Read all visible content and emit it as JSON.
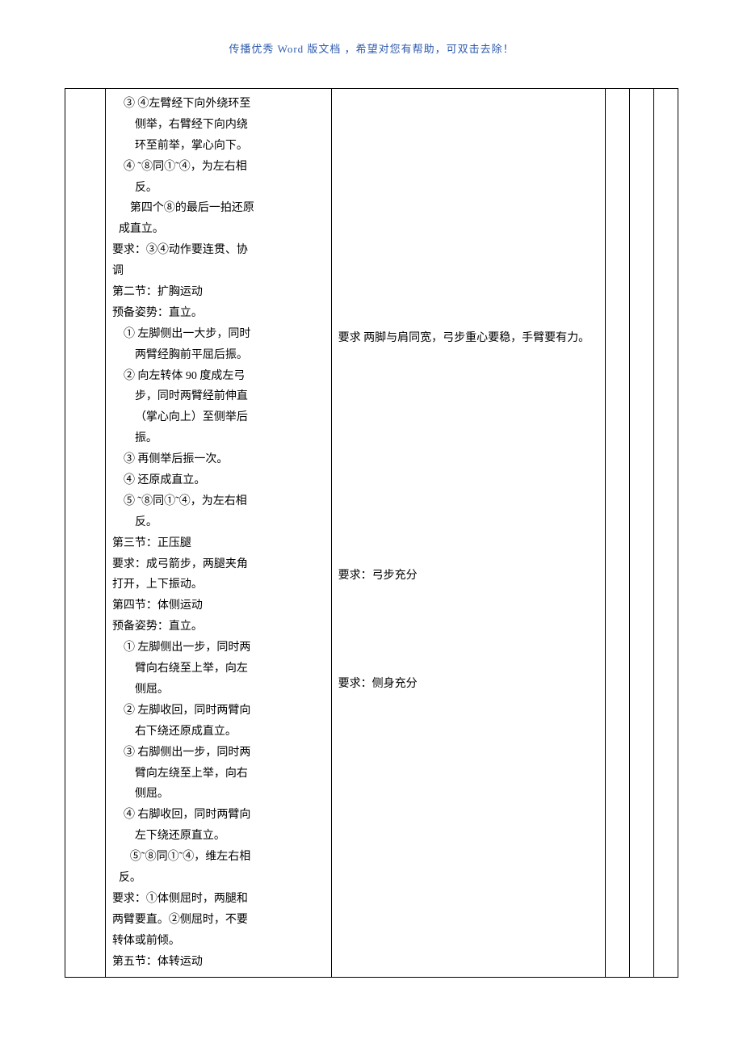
{
  "header": "传播优秀 Word 版文档 ，希望对您有帮助，可双击去除！",
  "col2": {
    "lines": [
      {
        "cls": "indent",
        "t": "③ ④左臂经下向外绕环至"
      },
      {
        "cls": "indent2",
        "t": "侧举，右臂经下向内绕"
      },
      {
        "cls": "indent2",
        "t": "环至前举，掌心向下。"
      },
      {
        "cls": "indent",
        "t": "④ ˜⑧同①˜④，为左右相"
      },
      {
        "cls": "indent2",
        "t": "反。"
      },
      {
        "cls": "numbered",
        "t": "　第四个⑧的最后一拍还原"
      },
      {
        "cls": "numbered",
        "t": "成直立。"
      },
      {
        "cls": "plain",
        "t": "要求：③④动作要连贯、协"
      },
      {
        "cls": "plain",
        "t": "调"
      },
      {
        "cls": "plain",
        "t": "第二节：扩胸运动"
      },
      {
        "cls": "plain",
        "t": "预备姿势：直立。"
      },
      {
        "cls": "indent",
        "t": "① 左脚侧出一大步，同时"
      },
      {
        "cls": "indent2",
        "t": "两臂经胸前平屈后振。"
      },
      {
        "cls": "indent",
        "t": "② 向左转体 90 度成左弓"
      },
      {
        "cls": "indent2",
        "t": "步，同时两臂经前伸直"
      },
      {
        "cls": "indent2",
        "t": "（掌心向上）至侧举后"
      },
      {
        "cls": "indent2",
        "t": "振。"
      },
      {
        "cls": "indent",
        "t": "③ 再侧举后振一次。"
      },
      {
        "cls": "indent",
        "t": "④ 还原成直立。"
      },
      {
        "cls": "indent",
        "t": "⑤ ˜⑧同①˜④，为左右相"
      },
      {
        "cls": "indent2",
        "t": "反。"
      },
      {
        "cls": "plain",
        "t": "第三节：正压腿"
      },
      {
        "cls": "plain",
        "t": "要求：成弓箭步，两腿夹角"
      },
      {
        "cls": "plain",
        "t": "打开，上下振动。"
      },
      {
        "cls": "plain",
        "t": "第四节：体侧运动"
      },
      {
        "cls": "plain",
        "t": "预备姿势：直立。"
      },
      {
        "cls": "indent",
        "t": "① 左脚侧出一步，同时两"
      },
      {
        "cls": "indent2",
        "t": "臂向右绕至上举，向左"
      },
      {
        "cls": "indent2",
        "t": "侧屈。"
      },
      {
        "cls": "indent",
        "t": "② 左脚收回，同时两臂向"
      },
      {
        "cls": "indent2",
        "t": "右下绕还原成直立。"
      },
      {
        "cls": "indent",
        "t": "③ 右脚侧出一步，同时两"
      },
      {
        "cls": "indent2",
        "t": "臂向左绕至上举，向右"
      },
      {
        "cls": "indent2",
        "t": "侧屈。"
      },
      {
        "cls": "indent",
        "t": "④ 右脚收回，同时两臂向"
      },
      {
        "cls": "indent2",
        "t": "左下绕还原直立。"
      },
      {
        "cls": "numbered",
        "t": "　⑤˜⑧同①˜④，维左右相"
      },
      {
        "cls": "numbered",
        "t": "反。"
      },
      {
        "cls": "plain",
        "t": "要求：①体侧屈时，两腿和"
      },
      {
        "cls": "plain",
        "t": "两臂要直。②侧屈时，不要"
      },
      {
        "cls": "plain",
        "t": "转体或前倾。"
      },
      {
        "cls": "plain",
        "t": "第五节：体转运动"
      }
    ]
  },
  "col3": {
    "req1": "要求 两脚与肩同宽，弓步重心要稳，手臂要有力。",
    "req2": "要求：弓步充分",
    "req3": "要求：侧身充分"
  }
}
